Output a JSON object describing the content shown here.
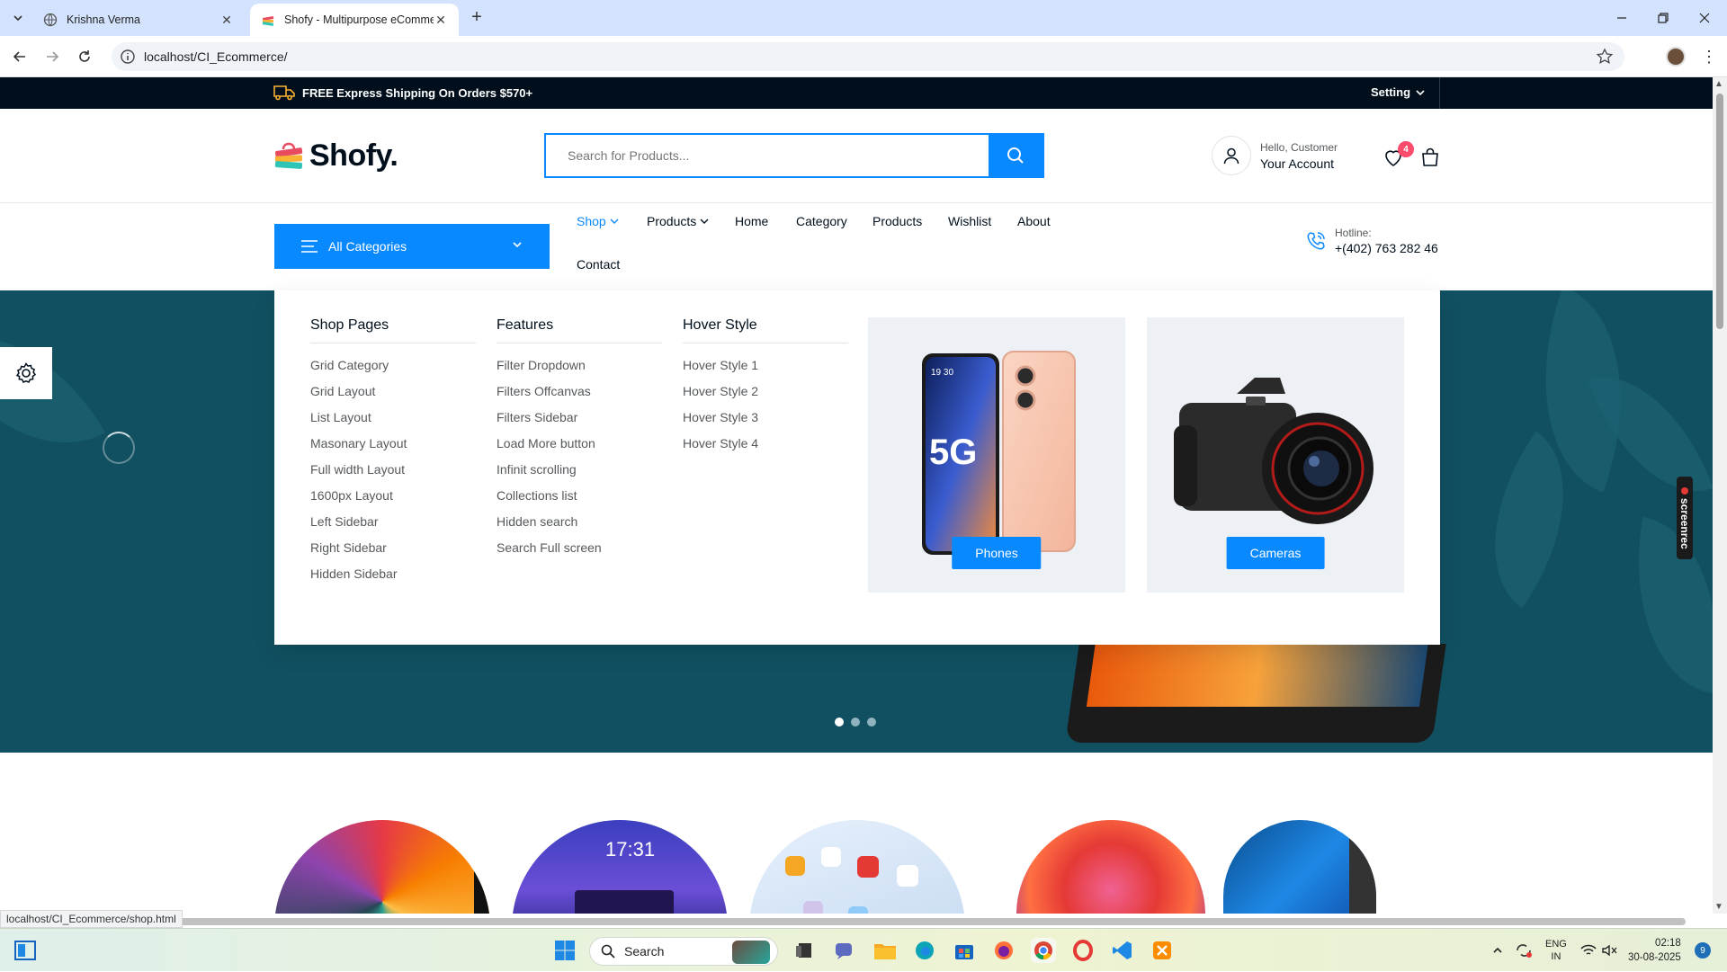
{
  "browser": {
    "tabs": [
      {
        "title": "Krishna Verma"
      },
      {
        "title": "Shofy - Multipurpose eCommer"
      }
    ],
    "url": "localhost/CI_Ecommerce/",
    "status_url": "localhost/CI_Ecommerce/shop.html"
  },
  "topbar": {
    "shipping_text": "FREE Express Shipping On Orders $570+",
    "setting_label": "Setting"
  },
  "header": {
    "logo_text": "Shofy.",
    "search_placeholder": "Search for Products...",
    "account_greeting": "Hello, Customer",
    "account_label": "Your Account",
    "wishlist_count": "4"
  },
  "nav": {
    "all_categories": "All Categories",
    "items": [
      {
        "label": "Shop"
      },
      {
        "label": "Products"
      },
      {
        "label": "Home"
      },
      {
        "label": "Category"
      },
      {
        "label": "Products"
      },
      {
        "label": "Wishlist"
      },
      {
        "label": "About"
      },
      {
        "label": "Contact"
      }
    ],
    "hotline_label": "Hotline:",
    "hotline_number": "+(402) 763 282 46"
  },
  "mega_menu": {
    "columns": [
      {
        "title": "Shop Pages",
        "links": [
          "Grid Category",
          "Grid Layout",
          "List Layout",
          "Masonary Layout",
          "Full width Layout",
          "1600px Layout",
          "Left Sidebar",
          "Right Sidebar",
          "Hidden Sidebar"
        ]
      },
      {
        "title": "Features",
        "links": [
          "Filter Dropdown",
          "Filters Offcanvas",
          "Filters Sidebar",
          "Load More button",
          "Infinit scrolling",
          "Collections list",
          "Hidden search",
          "Search Full screen"
        ]
      },
      {
        "title": "Hover Style",
        "links": [
          "Hover Style 1",
          "Hover Style 2",
          "Hover Style 3",
          "Hover Style 4"
        ]
      }
    ],
    "cards": [
      {
        "label": "Phones",
        "phone_badge": "5G",
        "phone_time": "19 30"
      },
      {
        "label": "Cameras"
      }
    ]
  },
  "product_images": {
    "tablet_clock": "17:31"
  },
  "screenrec_label": "screenrec",
  "taskbar": {
    "search_label": "Search",
    "lang_line1": "ENG",
    "lang_line2": "IN",
    "time": "02:18",
    "date": "30-08-2025",
    "notifications": "9"
  },
  "colors": {
    "brand_blue": "#0989ff",
    "hero_teal": "#115061",
    "topbar_dark": "#010f1c",
    "badge_red": "#fd4b6b"
  }
}
